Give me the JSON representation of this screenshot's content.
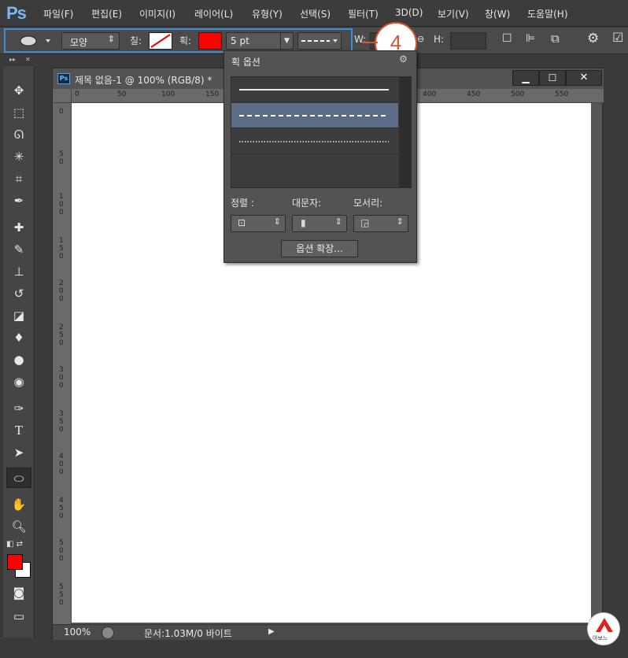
{
  "app": {
    "logo": "Ps"
  },
  "menu": [
    "파일(F)",
    "편집(E)",
    "이미지(I)",
    "레이어(L)",
    "유형(Y)",
    "선택(S)",
    "필터(T)",
    "3D(D)",
    "보기(V)",
    "창(W)",
    "도움말(H)"
  ],
  "options": {
    "mode": "모양",
    "fill_label": "칠:",
    "stroke_label": "획:",
    "stroke_width": "5 pt",
    "w_label": "W:",
    "h_label": "H:",
    "stroke_color": "#ff0000"
  },
  "step": {
    "number": "4"
  },
  "document": {
    "title": "제목 없음-1 @ 100% (RGB/8) *",
    "ruler_top": [
      "0",
      "50",
      "100",
      "150",
      "400",
      "450",
      "500",
      "550"
    ],
    "ruler_left": [
      "0",
      "5\n0",
      "1\n0\n0",
      "1\n5\n0",
      "2\n0\n0",
      "2\n5\n0",
      "3\n0\n0",
      "3\n5\n0",
      "4\n0\n0",
      "4\n5\n0",
      "5\n0\n0",
      "5\n5\n0"
    ],
    "zoom": "100%",
    "doc_info": "문서:1.03M/0 바이트"
  },
  "stroke_popup": {
    "title": "획 옵션",
    "align_label": "정렬 :",
    "caps_label": "대문자:",
    "corners_label": "모서리:",
    "more_button": "옵션 확장..."
  },
  "badge": {
    "text": "아보느"
  }
}
